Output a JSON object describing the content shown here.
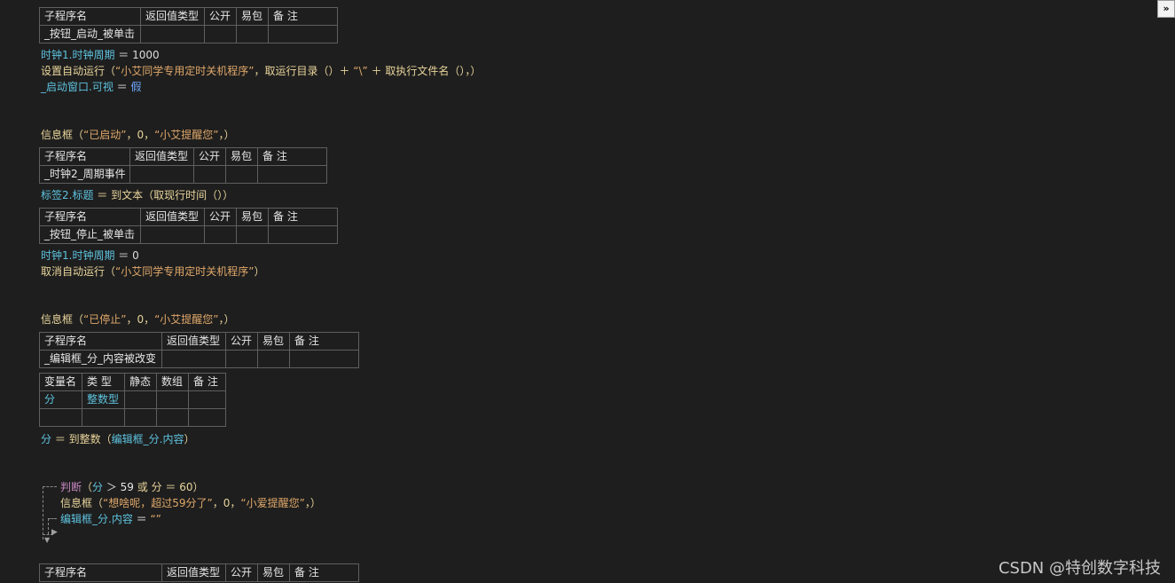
{
  "corner_button": "»",
  "watermark": "CSDN @特创数字科技",
  "headers": {
    "sub": [
      "子程序名",
      "返回值类型",
      "公开",
      "易包",
      "备 注"
    ],
    "var": [
      "变量名",
      "类 型",
      "静态",
      "数组",
      "备 注"
    ]
  },
  "sub1": {
    "name": "_按钮_启动_被单击"
  },
  "sub2": {
    "name": "_时钟2_周期事件"
  },
  "sub3": {
    "name": "_按钮_停止_被单击"
  },
  "sub4": {
    "name": "_编辑框_分_内容被改变"
  },
  "var_row": {
    "name": "分",
    "type": "整数型"
  },
  "code": {
    "l1_obj": "时钟1.时钟周期",
    "l1_rest": " ＝ 1000",
    "l2_cmd": "设置自动运行（",
    "l2_str": "“小艾同学专用定时关机程序”",
    "l2_mid": "，取运行目录（）＋ ",
    "l2_str2": "“\\”",
    "l2_end": " ＋ 取执行文件名（），）",
    "l3_obj": "_启动窗口.可视",
    "l3_eq": " ＝ ",
    "l3_val": "假",
    "l4_cmd": "信息框（",
    "l4_str": "“已启动”",
    "l4_mid": "，0，",
    "l4_str2": "“小艾提醒您”",
    "l4_end": "，）",
    "l5_obj": "标签2.标题",
    "l5_rest": " ＝ 到文本（取现行时间（））",
    "l6_obj": "时钟1.时钟周期",
    "l6_rest": " ＝ 0",
    "l7_cmd": "取消自动运行（",
    "l7_str": "“小艾同学专用定时关机程序”",
    "l7_end": "）",
    "l8_cmd": "信息框（",
    "l8_str": "“已停止”",
    "l8_mid": "，0，",
    "l8_str2": "“小艾提醒您”",
    "l8_end": "，）",
    "l9_a": "分",
    "l9_b": " ＝ 到整数（",
    "l9_c": "编辑框_分.内容",
    "l9_d": "）",
    "l10_kw": "判断",
    "l10_a": "（",
    "l10_b": "分",
    "l10_c": " ＞ 59 ",
    "l10_d": "或",
    "l10_e": " 分 ＝ 60）",
    "l11_cmd": "信息框（",
    "l11_str": "“想啥呢，超过59分了”",
    "l11_mid": "，0，",
    "l11_str2": "“小爱提醒您”",
    "l11_end": "，）",
    "l12_obj": "编辑框_分.内容",
    "l12_eq": " ＝ ",
    "l12_str": "“”"
  }
}
